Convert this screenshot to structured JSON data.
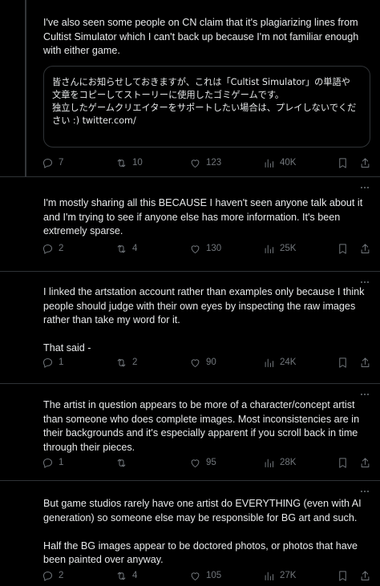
{
  "tweets": [
    {
      "text": "I've also seen some people on CN claim that it's plagiarizing lines from Cultist Simulator which I can't back up because I'm not familiar enough with either game.",
      "quote_text": "皆さんにお知らせしておきますが、これは「Cultist Simulator」の単語や文章をコピーしてストーリーに使用したゴミゲームです。\n独立したゲームクリエイターをサポートしたい場合は、プレイしないでください :) twitter.com/",
      "replies": "7",
      "reposts": "10",
      "likes": "123",
      "views": "40K"
    },
    {
      "text": "I'm mostly sharing all this BECAUSE I haven't seen anyone talk about it and I'm trying to see if anyone else has more information. It's been extremely sparse.",
      "replies": "2",
      "reposts": "4",
      "likes": "130",
      "views": "25K"
    },
    {
      "text": "I linked the artstation account rather than examples only because I think people should judge with their own eyes by inspecting the raw images rather than take my word for it.\n\nThat said -",
      "replies": "1",
      "reposts": "2",
      "likes": "90",
      "views": "24K"
    },
    {
      "text": "The artist in question appears to be more of a character/concept artist than someone who does complete images. Most inconsistencies are in their backgrounds and it's especially apparent if you scroll back in time through their pieces.",
      "replies": "1",
      "reposts": "",
      "likes": "95",
      "views": "28K"
    },
    {
      "text": "But game studios rarely have one artist do EVERYTHING (even with AI generation) so someone else may be responsible for BG art and such.\n\nHalf the BG images appear to be doctored photos, or photos that have been painted over anyway.",
      "replies": "2",
      "reposts": "4",
      "likes": "105",
      "views": "27K"
    }
  ],
  "icons": {
    "reply": "reply-icon",
    "repost": "repost-icon",
    "like": "heart-icon",
    "views": "views-icon",
    "bookmark": "bookmark-icon",
    "share": "share-icon",
    "more": "more-icon"
  },
  "colors": {
    "background": "#000000",
    "text": "#e7e9ea",
    "muted": "#71767b",
    "border": "#2f3336"
  }
}
